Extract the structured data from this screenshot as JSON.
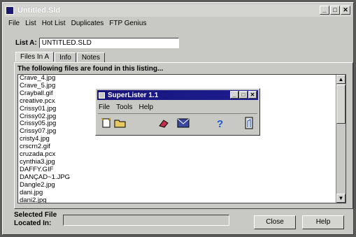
{
  "main_window": {
    "title": "Untitled.Sld",
    "controls": {
      "minimize": "_",
      "maximize": "□",
      "close": "✕"
    }
  },
  "menu": [
    "File",
    "List",
    "Hot List",
    "Duplicates",
    "FTP Genius"
  ],
  "list_field": {
    "label": "List A:",
    "value": "UNTITLED.SLD"
  },
  "tabs": [
    "Files In A",
    "Info",
    "Notes"
  ],
  "files_heading": "The following files are found in this listing...",
  "files": [
    "Crave_4.jpg",
    "Crave_5.jpg",
    "Crayball.gif",
    "creative.pcx",
    "Crissy01.jpg",
    "Crissy02.jpg",
    "Crissy05.jpg",
    "Crissy07.jpg",
    "cristy4.jpg",
    "crscrn2.gif",
    "cruzada.pcx",
    "cynthia3.jpg",
    "DAFFY.GIF",
    "DANÇAD~1.JPG",
    "Dangle2.jpg",
    "dani.jpg",
    "dani2.jpg"
  ],
  "bottom": {
    "selected_file_label": "Selected File",
    "located_in_label": "Located In:"
  },
  "buttons": {
    "close": "Close",
    "help": "Help"
  },
  "dialog": {
    "title": "SuperLister 1.1",
    "menu": [
      "File",
      "Tools",
      "Help"
    ],
    "toolbar_icons": [
      "new-list-icon",
      "open-folder-icon",
      "eraser-icon",
      "mail-icon",
      "help-question-icon",
      "exit-door-icon"
    ]
  },
  "colors": {
    "window_bg": "#c8c8c4",
    "dialog_title_bg": "#17157a",
    "desktop_bg": "#5a5a58"
  }
}
